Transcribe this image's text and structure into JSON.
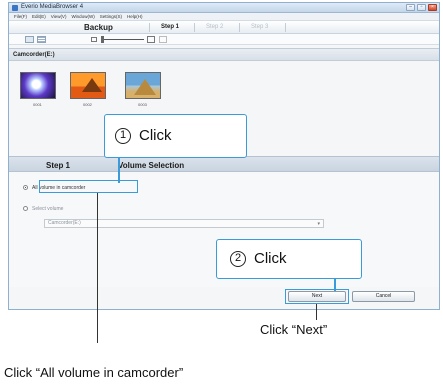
{
  "window": {
    "title": "Everio MediaBrowser 4",
    "controls": [
      "–",
      "▫",
      "×"
    ]
  },
  "menu": [
    "File(F)",
    "Edit(E)",
    "View(V)",
    "Window(W)",
    "Settings(S)",
    "Help(H)"
  ],
  "stepbar": {
    "mode_title": "Backup",
    "steps": [
      {
        "label": "Step 1",
        "active": true
      },
      {
        "label": "Step 2",
        "active": false
      },
      {
        "label": "Step 3",
        "active": false
      }
    ]
  },
  "source": {
    "header": "Camcorder(E:)",
    "thumbnails": [
      {
        "caption": "0001",
        "icon": "galaxy-thumbnail"
      },
      {
        "caption": "0002",
        "icon": "pyramid-sunset-thumbnail"
      },
      {
        "caption": "0003",
        "icon": "pyramid-day-thumbnail"
      }
    ]
  },
  "step_panel": {
    "step_label": "Step 1",
    "title": "Volume Selection"
  },
  "options": {
    "all_volume_label": "All volume in camcorder",
    "select_volume_label": "Select volume",
    "select_value": "Camcorder(E:)"
  },
  "buttons": {
    "next": "Next",
    "cancel": "Cancel"
  },
  "callouts": [
    {
      "number": "1",
      "text": "Click"
    },
    {
      "number": "2",
      "text": "Click"
    }
  ],
  "annotations": {
    "next_caption": "Click “Next”",
    "all_volume_caption": "Click “All volume in camcorder”"
  },
  "colors": {
    "accent": "#3b9bd8",
    "titlebar": "#c3d6ea"
  }
}
